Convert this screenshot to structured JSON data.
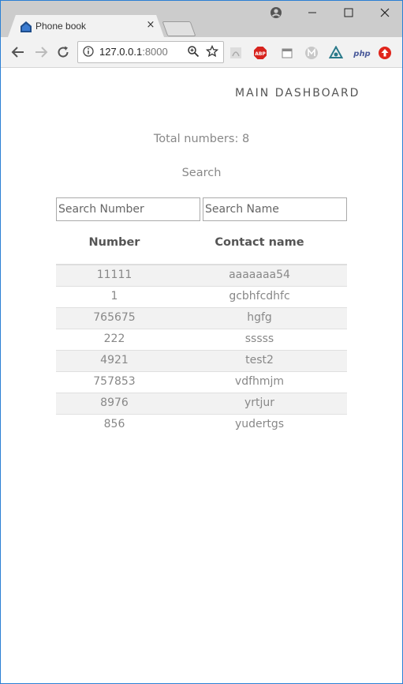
{
  "browser": {
    "tab_title": "Phone book",
    "tab_close": "×",
    "url_host": "127.0.0.1",
    "url_port": ":8000",
    "accent_color": "#2b7fd4"
  },
  "page": {
    "dashboard_link": "MAIN DASHBOARD",
    "total_numbers": "Total numbers: 8",
    "search_label": "Search",
    "search_number_placeholder": "Search Number",
    "search_name_placeholder": "Search Name",
    "table": {
      "headers": [
        "Number",
        "Contact name"
      ],
      "rows": [
        [
          "11111",
          "aaaaaaa54"
        ],
        [
          "1",
          "gcbhfcdhfc"
        ],
        [
          "765675",
          "hgfg"
        ],
        [
          "222",
          "sssss"
        ],
        [
          "4921",
          "test2"
        ],
        [
          "757853",
          "vdfhmjm"
        ],
        [
          "8976",
          "yrtjur"
        ],
        [
          "856",
          "yudertgs"
        ]
      ]
    }
  }
}
